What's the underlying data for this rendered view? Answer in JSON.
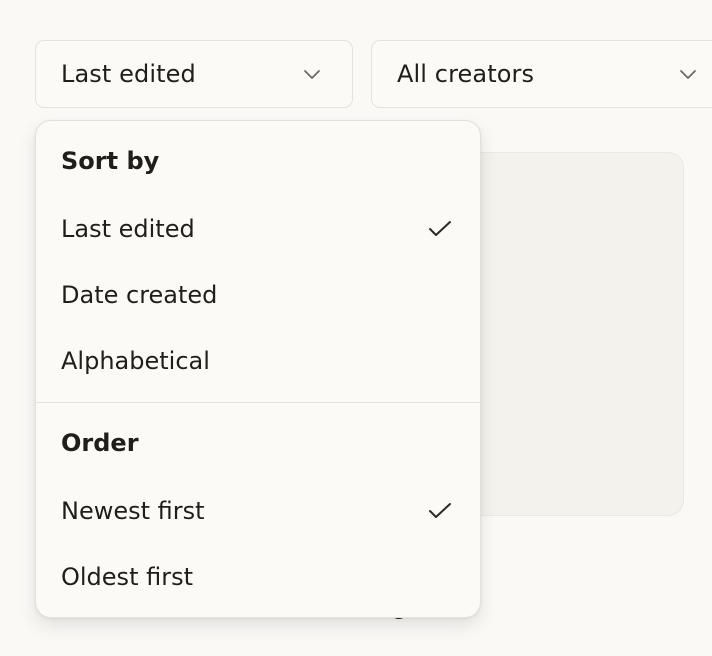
{
  "filters": {
    "sort_value": "Last edited",
    "creator_value": "All creators"
  },
  "background": {
    "peek_text": "g"
  },
  "menu": {
    "sort_heading": "Sort by",
    "sort_items": [
      {
        "label": "Last edited",
        "selected": true
      },
      {
        "label": "Date created",
        "selected": false
      },
      {
        "label": "Alphabetical",
        "selected": false
      }
    ],
    "order_heading": "Order",
    "order_items": [
      {
        "label": "Newest first",
        "selected": true
      },
      {
        "label": "Oldest first",
        "selected": false
      }
    ]
  },
  "icons": {
    "dropdown": "chevron-down-icon",
    "selected": "checkmark-icon"
  },
  "colors": {
    "page_background": "#faf9f6",
    "card_background": "#f4f2ec",
    "text": "#1f1e1b",
    "border": "#e6e3dc"
  }
}
